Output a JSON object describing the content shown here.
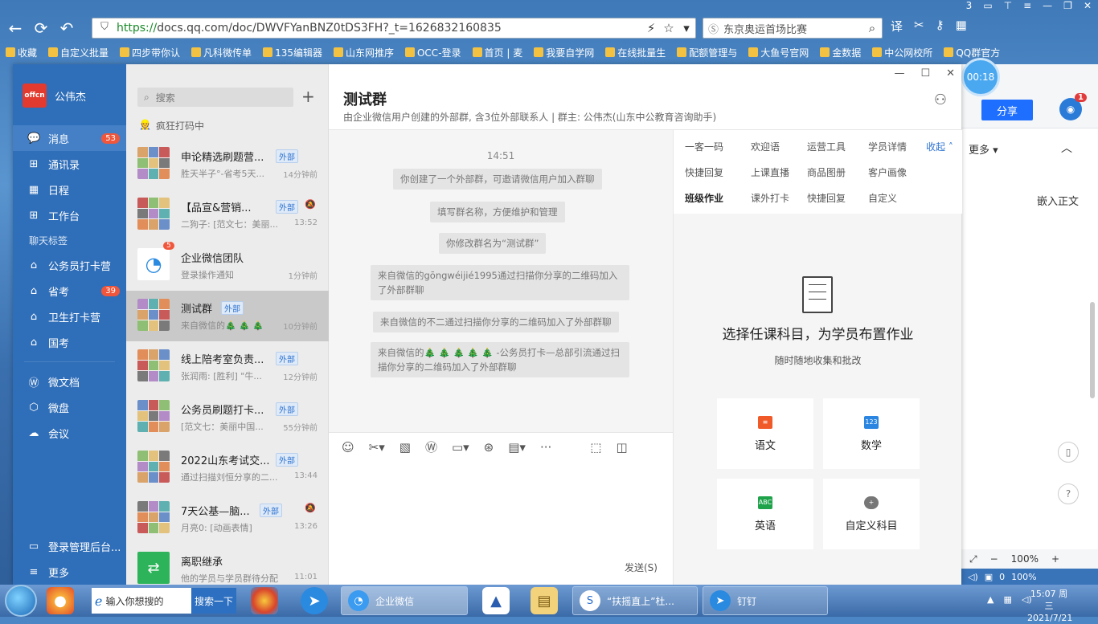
{
  "browser": {
    "url_scheme": "https://",
    "url_rest": "docs.qq.com/doc/DWVFYanBNZ0tDS3FH?_t=1626832160835",
    "search_text": "东京奥运首场比赛",
    "translate_label": "译",
    "top_badge": "3"
  },
  "favorites": [
    "收藏",
    "自定义批量",
    "四步带你认",
    "凡科微传单",
    "135编辑器",
    "山东网推序",
    "OCC-登录",
    "首页 | 麦",
    "我要自学网",
    "在线批量生",
    "配额管理与",
    "大鱼号官网",
    "金数据",
    "中公网校所",
    "QQ群官方"
  ],
  "doc": {
    "share_label": "分享",
    "more_label": "更多",
    "embed_label": "嵌入正文",
    "zoom": "100%",
    "status_right": "100%",
    "status_zero": "0",
    "timer": "00:18",
    "avatar_badge": "1"
  },
  "app": {
    "user": "公伟杰",
    "logo_text": "offcn",
    "nav": [
      {
        "label": "消息",
        "badge": "53",
        "icon": "message-icon"
      },
      {
        "label": "通讯录",
        "badge": "",
        "icon": "contacts-icon"
      },
      {
        "label": "日程",
        "badge": "",
        "icon": "calendar-icon"
      },
      {
        "label": "工作台",
        "badge": "",
        "icon": "workbench-icon"
      }
    ],
    "section_label": "聊天标签",
    "tags": [
      {
        "label": "公务员打卡营",
        "badge": ""
      },
      {
        "label": "省考",
        "badge": "39"
      },
      {
        "label": "卫生打卡营",
        "badge": ""
      },
      {
        "label": "国考",
        "badge": ""
      }
    ],
    "nav2": [
      {
        "label": "微文档"
      },
      {
        "label": "微盘"
      },
      {
        "label": "会议"
      }
    ],
    "bottom": [
      {
        "label": "登录管理后台..."
      },
      {
        "label": "更多"
      }
    ]
  },
  "list": {
    "search_placeholder": "搜索",
    "status": "疯狂打码中",
    "conversations": [
      {
        "name": "申论精选刷题营...",
        "tag": "外部",
        "msg": "胜天半子°-省考5天...",
        "time": "14分钟前",
        "muted": false
      },
      {
        "name": "【品宣&营销...",
        "tag": "外部",
        "msg": "二狗子: [范文七：美丽...",
        "time": "13:52",
        "muted": true
      },
      {
        "name": "企业微信团队",
        "tag": "",
        "msg": "登录操作通知",
        "time": "1分钟前",
        "muted": false,
        "badge": "5"
      },
      {
        "name": "测试群",
        "tag": "外部",
        "msg": "来自微信的🎄 🎄 🎄",
        "time": "10分钟前",
        "muted": false
      },
      {
        "name": "线上陪考室负责...",
        "tag": "外部",
        "msg": "张润雨: [胜利] \"牛...",
        "time": "12分钟前",
        "muted": false
      },
      {
        "name": "公务员刷题打卡...",
        "tag": "外部",
        "msg": "[范文七：美丽中国...",
        "time": "55分钟前",
        "muted": false
      },
      {
        "name": "2022山东考试交...",
        "tag": "外部",
        "msg": "通过扫描刘恒分享的二...",
        "time": "13:44",
        "muted": false
      },
      {
        "name": "7天公基—脑...",
        "tag": "外部",
        "msg": "月亮0: [动画表情]",
        "time": "13:26",
        "muted": true
      },
      {
        "name": "离职继承",
        "tag": "",
        "msg": "他的学员与学员群待分配",
        "time": "11:01",
        "muted": false
      }
    ]
  },
  "chat": {
    "title": "测试群",
    "subtitle": "由企业微信用户创建的外部群, 含3位外部联系人 | 群主: 公伟杰(山东中公教育咨询助手)",
    "time": "14:51",
    "messages": [
      "你创建了一个外部群，可邀请微信用户加入群聊",
      "填写群名称，方便维护和管理",
      "你修改群名为“测试群”",
      "来自微信的gōngwéijié1995通过扫描你分享的二维码加入了外部群聊",
      "来自微信的不二通过扫描你分享的二维码加入了外部群聊",
      "来自微信的🎄 🎄 🎄 🎄 🎄 -公务员打卡—总部引流通过扫描你分享的二维码加入了外部群聊"
    ],
    "send_label": "发送(S)"
  },
  "panel": {
    "tabs_row1": [
      "一客一码",
      "欢迎语",
      "运营工具",
      "学员详情"
    ],
    "fold_label": "收起",
    "tabs_row2": [
      "快捷回复",
      "上课直播",
      "商品图册",
      "客户画像"
    ],
    "tabs_row3": [
      "班级作业",
      "课外打卡",
      "快捷回复",
      "自定义"
    ],
    "heading": "选择任课科目，为学员布置作业",
    "subheading": "随时随地收集和批改",
    "subjects": [
      {
        "label": "语文",
        "icon": "chinese-icon",
        "color": "#f05a28"
      },
      {
        "label": "数学",
        "icon": "math-icon",
        "color": "#2a86e0",
        "badge": "123"
      },
      {
        "label": "英语",
        "icon": "english-icon",
        "color": "#1fa34a",
        "badge": "ABC"
      },
      {
        "label": "自定义科目",
        "icon": "add-icon",
        "color": "#777"
      }
    ]
  },
  "taskbar": {
    "ie_text": "输入你想搜的",
    "ie_button": "搜索一下",
    "tasks": [
      {
        "label": "企业微信"
      },
      {
        "label": "“扶摇直上”杜..."
      },
      {
        "label": "钉钉"
      }
    ],
    "time": "15:07 周三",
    "date": "2021/7/21"
  }
}
